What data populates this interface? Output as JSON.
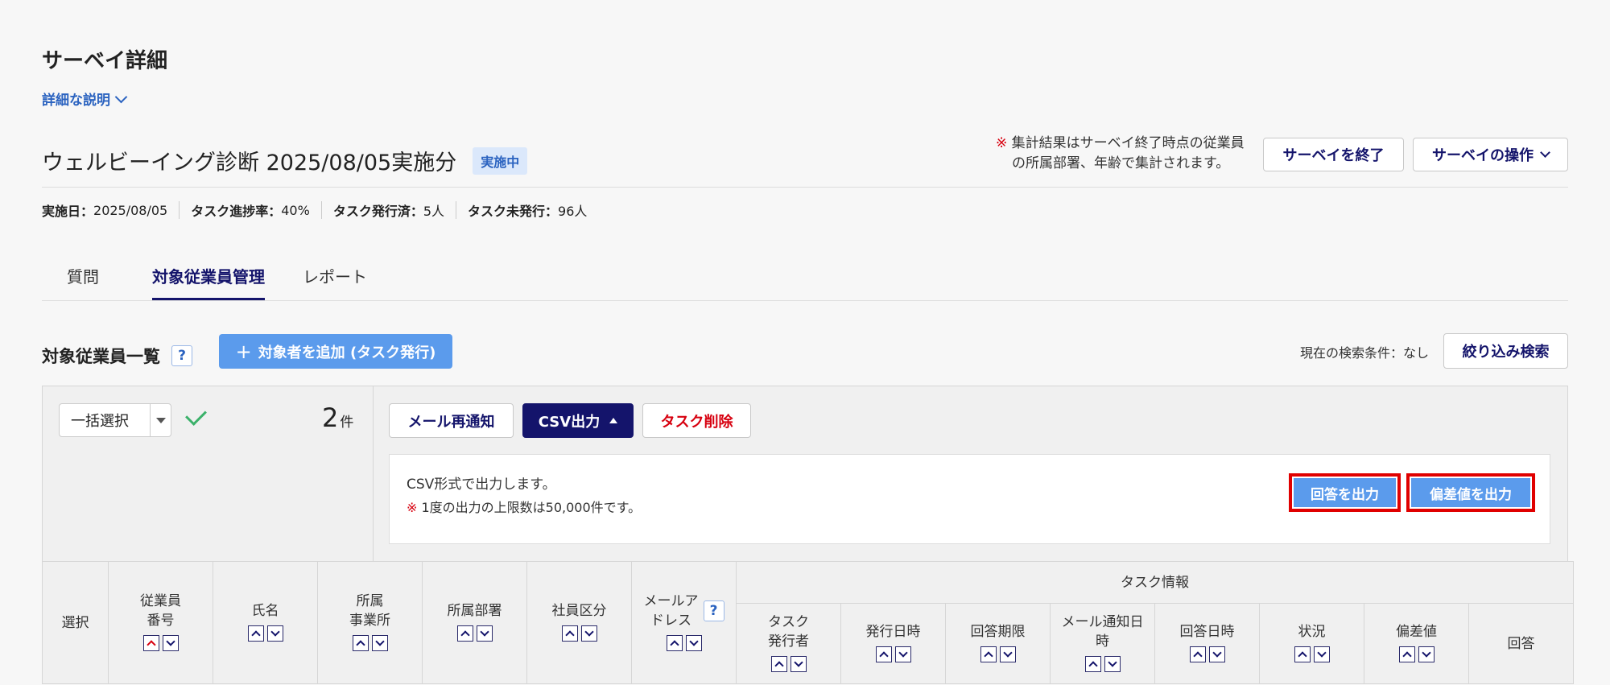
{
  "page": {
    "title": "サーベイ詳細",
    "detail_link": "詳細な説明"
  },
  "survey": {
    "name": "ウェルビーイング診断 2025/08/05実施分",
    "status_badge": "実施中",
    "note_mark": "※",
    "note_line1": "集計結果はサーベイ終了時点の従業員",
    "note_line2": "の所属部署、年齢で集計されます。",
    "end_button": "サーベイを終了",
    "ops_button": "サーベイの操作"
  },
  "stats": [
    {
      "label": "実施日：",
      "value": "2025/08/05"
    },
    {
      "label": "タスク進捗率：",
      "value": "40%"
    },
    {
      "label": "タスク発行済：",
      "value": "5人"
    },
    {
      "label": "タスク未発行：",
      "value": "96人"
    }
  ],
  "tabs": [
    {
      "label": "質問",
      "active": false
    },
    {
      "label": "対象従業員管理",
      "active": true
    },
    {
      "label": "レポート",
      "active": false
    }
  ],
  "list": {
    "title": "対象従業員一覧",
    "help": "?",
    "add_button": "対象者を追加 (タスク発行)",
    "add_icon": "+",
    "search_condition": "現在の検索条件：なし",
    "filter_button": "絞り込み検索"
  },
  "bulk": {
    "select_label": "一括選択",
    "count": "2",
    "count_unit": "件",
    "mail_button": "メール再通知",
    "csv_button": "CSV出力",
    "delete_button": "タスク削除",
    "csv_text": "CSV形式で出力します。",
    "csv_note_mark": "※",
    "csv_note": "1度の出力の上限数は50,000件です。",
    "export_answers": "回答を出力",
    "export_deviation": "偏差値を出力"
  },
  "table": {
    "select": "選択",
    "employee_no": [
      "従業員",
      "番号"
    ],
    "name": "氏名",
    "office": [
      "所属",
      "事業所"
    ],
    "dept": "所属部署",
    "emp_type": "社員区分",
    "mail": [
      "メールア",
      "ドレス"
    ],
    "task_group": "タスク情報",
    "task_issuer": [
      "タスク",
      "発行者"
    ],
    "issued_at": "発行日時",
    "deadline": "回答期限",
    "mail_notice": [
      "メール通知日",
      "時"
    ],
    "answered_at": "回答日時",
    "status": "状況",
    "deviation": "偏差値",
    "answer": "回答"
  },
  "colors": {
    "navy": "#14146b",
    "accent_blue": "#5b9bec",
    "link_blue": "#2b63c0",
    "warning_red": "#d7000f",
    "highlight_red": "#e00000",
    "check_green": "#3bb16a"
  }
}
